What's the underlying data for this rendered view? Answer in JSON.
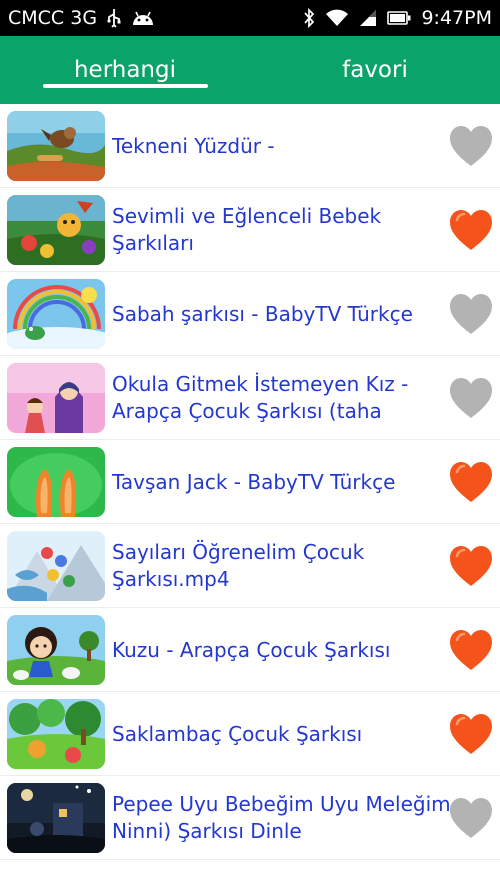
{
  "status_bar": {
    "carrier": "CMCC 3G",
    "time": "9:47PM",
    "icons": [
      "usb-icon",
      "android-icon",
      "bluetooth-icon",
      "wifi-icon",
      "signal-icon",
      "battery-icon"
    ]
  },
  "tabs": [
    {
      "label": "herhangi",
      "selected": true
    },
    {
      "label": "favori",
      "selected": false
    }
  ],
  "colors": {
    "header": "#0aa36a",
    "title_text": "#2438cf",
    "heart_fav": "#f4541c",
    "heart_off": "#b3b3b3"
  },
  "videos": [
    {
      "title": "Tekneni Yüzdür -",
      "favorite": false,
      "thumbnail": "cartoon-bird-landscape"
    },
    {
      "title": "Sevimli ve Eğlenceli Bebek Şarkıları",
      "favorite": true,
      "thumbnail": "cartoon-garden-characters"
    },
    {
      "title": "Sabah şarkısı  - BabyTV Türkçe",
      "favorite": false,
      "thumbnail": "cartoon-rainbow-morning"
    },
    {
      "title": "Okula Gitmek İstemeyen Kız - Arapça Çocuk Şarkısı (taha",
      "favorite": false,
      "thumbnail": "cartoon-mother-girl"
    },
    {
      "title": "Tavşan Jack - BabyTV Türkçe",
      "favorite": true,
      "thumbnail": "cartoon-bunny-ears"
    },
    {
      "title": "Sayıları Öğrenelim Çocuk Şarkısı.mp4",
      "favorite": true,
      "thumbnail": "cartoon-numbers-balloons"
    },
    {
      "title": "Kuzu - Arapça Çocuk Şarkısı",
      "favorite": true,
      "thumbnail": "cartoon-girl-sheep"
    },
    {
      "title": "Saklambaç Çocuk Şarkısı",
      "favorite": true,
      "thumbnail": "cartoon-forest-hide-seek"
    },
    {
      "title": "Pepee Uyu Bebeğim Uyu Meleğim Ninni) Şarkısı Dinle",
      "favorite": false,
      "thumbnail": "cartoon-night-lullaby"
    }
  ]
}
